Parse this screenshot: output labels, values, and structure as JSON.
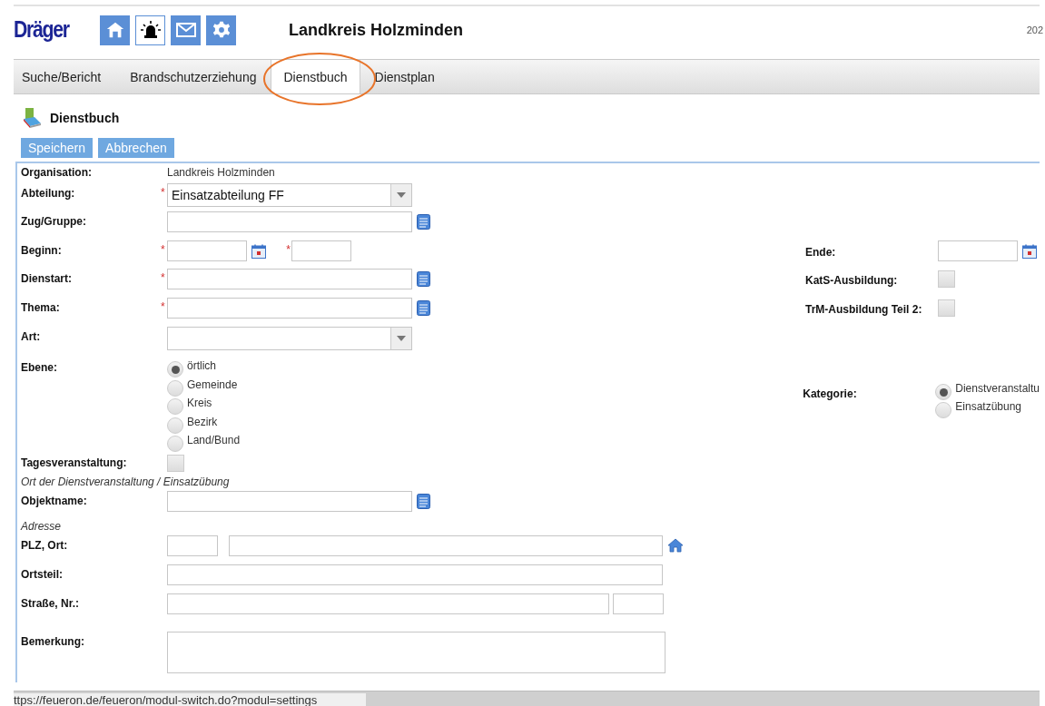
{
  "header": {
    "logo": "Dräger",
    "title": "Landkreis Holzminden",
    "date": "202"
  },
  "toolbar_icons": [
    {
      "kind": "home",
      "selected": false
    },
    {
      "kind": "alarm",
      "selected": true
    },
    {
      "kind": "mail",
      "selected": false
    },
    {
      "kind": "settings",
      "selected": false
    }
  ],
  "tabs": [
    {
      "label": "Suche/Bericht",
      "selected": false
    },
    {
      "label": "Brandschutzerziehung",
      "selected": false
    },
    {
      "label": "Dienstbuch",
      "selected": true
    },
    {
      "label": "Dienstplan",
      "selected": false
    }
  ],
  "page": {
    "title": "Dienstbuch"
  },
  "buttons": [
    "Speichern",
    "Abbrechen"
  ],
  "form": {
    "required_mark": "*",
    "rows": [
      {
        "label": "Organisation:",
        "kind": "static",
        "value": "Landkreis Holzminden"
      },
      {
        "label": "Abteilung:",
        "kind": "select",
        "required": true,
        "value": "Einsatzabteilung FF"
      },
      {
        "label": "Zug/Gruppe:",
        "kind": "lookup",
        "required": false
      },
      {
        "label": "Beginn:",
        "kind": "datetime",
        "required": true,
        "right": {
          "label": "Ende:",
          "kind": "date",
          "required": false
        }
      },
      {
        "label": "Dienstart:",
        "kind": "lookup",
        "required": true,
        "right": {
          "label": "KatS-Ausbildung:",
          "kind": "checkbox",
          "checked": false
        }
      },
      {
        "label": "Thema:",
        "kind": "lookup",
        "required": true,
        "right": {
          "label": "TrM-Ausbildung Teil 2:",
          "kind": "checkbox",
          "checked": false
        }
      },
      {
        "label": "Art:",
        "kind": "select",
        "required": false
      },
      {
        "label": "Ebene:",
        "kind": "radio",
        "options": [
          {
            "label": "örtlich",
            "selected": true
          },
          {
            "label": "Gemeinde",
            "selected": false
          },
          {
            "label": "Kreis",
            "selected": false
          },
          {
            "label": "Bezirk",
            "selected": false
          },
          {
            "label": "Land/Bund",
            "selected": false
          }
        ],
        "right": {
          "label": "Kategorie:",
          "kind": "radio",
          "options": [
            {
              "label": "Dienstveranstaltu",
              "selected": true
            },
            {
              "label": "Einsatzübung",
              "selected": false
            }
          ]
        }
      },
      {
        "label": "Tagesveranstaltung:",
        "kind": "checkbox",
        "checked": false
      },
      {
        "label": "Ort der Dienstveranstaltung / Einsatzübung",
        "kind": "heading"
      },
      {
        "label": "Objektname:",
        "kind": "lookup",
        "required": false
      },
      {
        "label": "Adresse",
        "kind": "heading"
      },
      {
        "label": "PLZ, Ort:",
        "kind": "place",
        "required": false
      },
      {
        "label": "Ortsteil:",
        "kind": "wide",
        "required": false
      },
      {
        "label": "Straße, Nr.:",
        "kind": "street",
        "required": false
      },
      {
        "label": "Bemerkung:",
        "kind": "textarea",
        "required": false
      }
    ]
  },
  "status_bar": {
    "url": "ttps://feueron.de/feueron/modul-switch.do?modul=settings"
  }
}
